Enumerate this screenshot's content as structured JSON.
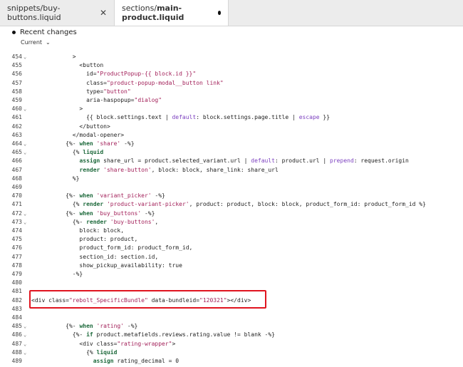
{
  "tabs": [
    {
      "label": "snippets/buy-buttons.liquid",
      "state": "inactive"
    },
    {
      "label_prefix": "sections/",
      "label_bold": "main-product.liquid",
      "state": "active_modified"
    }
  ],
  "changes": {
    "title": "Recent changes",
    "current": "Current"
  },
  "lines": [
    {
      "n": "454",
      "fold": true,
      "code": "            >"
    },
    {
      "n": "455",
      "code": "              <button"
    },
    {
      "n": "456",
      "code": "                id=\"ProductPopup-{{ block.id }}\""
    },
    {
      "n": "457",
      "code": "                class=\"product-popup-modal__button link\""
    },
    {
      "n": "458",
      "code": "                type=\"button\""
    },
    {
      "n": "459",
      "code": "                aria-haspopup=\"dialog\""
    },
    {
      "n": "460",
      "fold": true,
      "code": "              >"
    },
    {
      "n": "461",
      "code": "                {{ block.settings.text | default: block.settings.page.title | escape }}"
    },
    {
      "n": "462",
      "code": "              </button>"
    },
    {
      "n": "463",
      "code": "            </modal-opener>"
    },
    {
      "n": "464",
      "fold": true,
      "code": "          {%- when 'share' -%}"
    },
    {
      "n": "465",
      "fold": true,
      "code": "            {% liquid"
    },
    {
      "n": "466",
      "code": "              assign share_url = product.selected_variant.url | default: product.url | prepend: request.origin"
    },
    {
      "n": "467",
      "code": "              render 'share-button', block: block, share_link: share_url"
    },
    {
      "n": "468",
      "code": "            %}"
    },
    {
      "n": "469",
      "code": ""
    },
    {
      "n": "470",
      "code": "          {%- when 'variant_picker' -%}"
    },
    {
      "n": "471",
      "code": "            {% render 'product-variant-picker', product: product, block: block, product_form_id: product_form_id %}"
    },
    {
      "n": "472",
      "fold": true,
      "code": "          {%- when 'buy_buttons' -%}"
    },
    {
      "n": "473",
      "fold": true,
      "code": "            {%- render 'buy-buttons',"
    },
    {
      "n": "474",
      "code": "              block: block,"
    },
    {
      "n": "475",
      "code": "              product: product,"
    },
    {
      "n": "476",
      "code": "              product_form_id: product_form_id,"
    },
    {
      "n": "477",
      "code": "              section_id: section.id,"
    },
    {
      "n": "478",
      "code": "              show_pickup_availability: true"
    },
    {
      "n": "479",
      "code": "            -%}"
    },
    {
      "n": "480",
      "code": ""
    },
    {
      "n": "481",
      "code": ""
    },
    {
      "n": "482",
      "code": "<div class=\"rebolt_SpecificBundle\" data-bundleid=\"120321\"></div>"
    },
    {
      "n": "483",
      "code": ""
    },
    {
      "n": "484",
      "code": ""
    },
    {
      "n": "485",
      "fold": true,
      "code": "          {%- when 'rating' -%}"
    },
    {
      "n": "486",
      "fold": true,
      "code": "            {%- if product.metafields.reviews.rating.value != blank -%}"
    },
    {
      "n": "487",
      "fold": true,
      "code": "              <div class=\"rating-wrapper\">"
    },
    {
      "n": "488",
      "fold": true,
      "code": "                {% liquid"
    },
    {
      "n": "489",
      "code": "                  assign rating_decimal = 0"
    }
  ],
  "colors": {
    "highlight": "#e0141f",
    "keyword": "#1e6a3c",
    "string": "#a3215a"
  }
}
